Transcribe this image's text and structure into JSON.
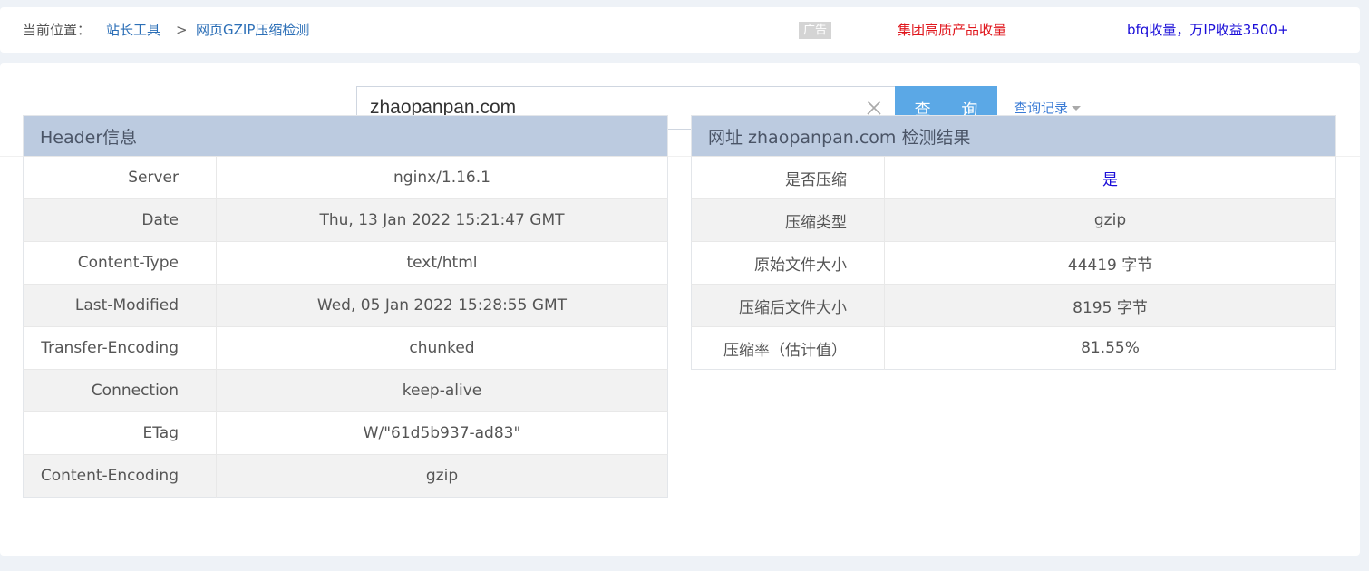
{
  "breadcrumb": {
    "label": "当前位置：",
    "link1": "站长工具",
    "separator": ">",
    "link2": "网页GZIP压缩检测"
  },
  "ads": {
    "badge": "广告",
    "link1": "集团高质产品收量",
    "link2": "bfq收量，万IP收益3500+"
  },
  "search": {
    "value": "zhaopanpan.com",
    "button": "查 询",
    "history": "查询记录"
  },
  "header_table": {
    "title": "Header信息",
    "rows": [
      {
        "key": "Server",
        "value": "nginx/1.16.1"
      },
      {
        "key": "Date",
        "value": "Thu, 13 Jan 2022 15:21:47 GMT"
      },
      {
        "key": "Content-Type",
        "value": "text/html"
      },
      {
        "key": "Last-Modified",
        "value": "Wed, 05 Jan 2022 15:28:55 GMT"
      },
      {
        "key": "Transfer-Encoding",
        "value": "chunked"
      },
      {
        "key": "Connection",
        "value": "keep-alive"
      },
      {
        "key": "ETag",
        "value": "W/\"61d5b937-ad83\""
      },
      {
        "key": "Content-Encoding",
        "value": "gzip"
      }
    ]
  },
  "result_table": {
    "title": "网址 zhaopanpan.com 检测结果",
    "rows": [
      {
        "key": "是否压缩",
        "value": "是"
      },
      {
        "key": "压缩类型",
        "value": "gzip"
      },
      {
        "key": "原始文件大小",
        "value": "44419 字节"
      },
      {
        "key": "压缩后文件大小",
        "value": "8195 字节"
      },
      {
        "key": "压缩率（估计值）",
        "value": "81.55%"
      }
    ]
  },
  "colors": {
    "table_header_bg": "#bccbe0",
    "button_bg": "#5ba8e6",
    "ad_red": "#e0161c",
    "ad_blue": "#1a0dd8"
  }
}
